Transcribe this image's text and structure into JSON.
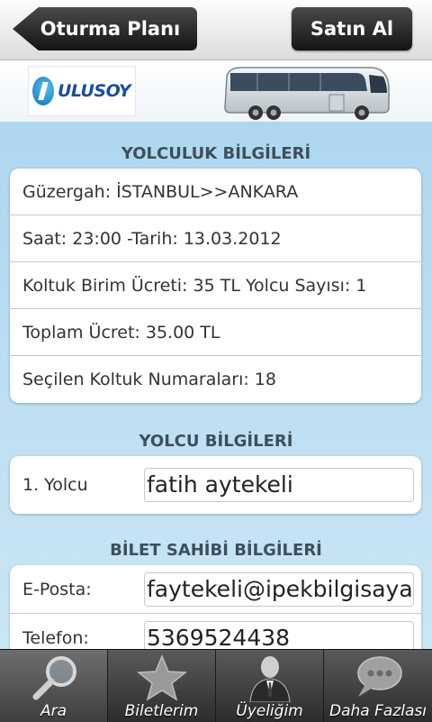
{
  "topbar": {
    "back_label": "Oturma Planı",
    "buy_label": "Satın Al"
  },
  "banner": {
    "logo_text": "ULUSOY"
  },
  "trip": {
    "title": "YOLCULUK BİLGİLERİ",
    "rows": [
      "Güzergah: İSTANBUL>>ANKARA",
      "Saat: 23:00 -Tarih: 13.03.2012",
      "Koltuk Birim Ücreti: 35 TL  Yolcu Sayısı: 1",
      "Toplam Ücret: 35.00 TL",
      "Seçilen Koltuk Numaraları: 18"
    ]
  },
  "passenger": {
    "title": "YOLCU BİLGİLERİ",
    "label": "1. Yolcu",
    "value": "fatih aytekeli"
  },
  "ticket_owner": {
    "title": "BİLET SAHİBİ BİLGİLERİ",
    "email_label": "E-Posta:",
    "email_value": "faytekeli@ipekbilgisayar.c",
    "phone_label": "Telefon:",
    "phone_value": "5369524438"
  },
  "tabs": [
    {
      "label": "Ara",
      "icon": "magnifier-icon",
      "active": true
    },
    {
      "label": "Biletlerim",
      "icon": "star-icon",
      "active": false
    },
    {
      "label": "Üyeliğim",
      "icon": "person-icon",
      "active": false
    },
    {
      "label": "Daha Fazlası",
      "icon": "speech-bubble-icon",
      "active": false
    }
  ],
  "colors": {
    "content_bg": "#aed7ef",
    "logo_blue": "#1a4d9a",
    "section_title": "#3d4f5c"
  }
}
